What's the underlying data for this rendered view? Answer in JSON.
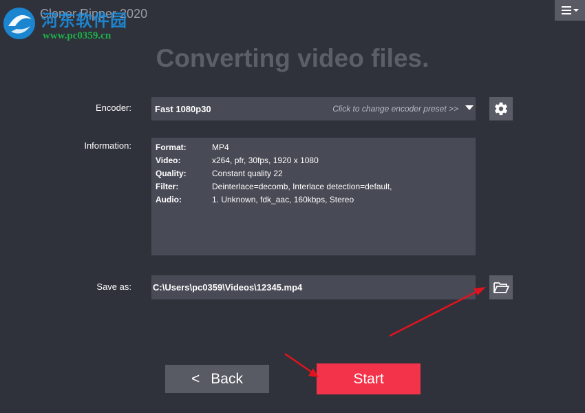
{
  "app": {
    "title": "Cloner Ripper 2020"
  },
  "watermark": {
    "site_name_cn": "河东软件园",
    "url": "www.pc0359.cn"
  },
  "heading": "Converting video files.",
  "encoder": {
    "label": "Encoder:",
    "value": "Fast 1080p30",
    "hint": "Click to change encoder preset >>"
  },
  "information": {
    "label": "Information:",
    "rows": [
      {
        "key": "Format:",
        "value": "MP4"
      },
      {
        "key": "Video:",
        "value": "x264, pfr, 30fps, 1920 x 1080"
      },
      {
        "key": "Quality:",
        "value": "Constant quality 22"
      },
      {
        "key": "Filter:",
        "value": "Deinterlace=decomb, Interlace detection=default,"
      },
      {
        "key": "Audio:",
        "value": "1. Unknown, fdk_aac, 160kbps, Stereo"
      }
    ]
  },
  "save_as": {
    "label": "Save as:",
    "value": "C:\\Users\\pc0359\\Videos\\12345.mp4"
  },
  "buttons": {
    "back_chevron": "<",
    "back_label": "Back",
    "start_label": "Start"
  },
  "icons": {
    "menu": "hamburger-menu-icon",
    "settings": "gear-icon",
    "folder": "folder-open-icon",
    "dropdown": "caret-down-icon"
  },
  "colors": {
    "background": "#2f313b",
    "panel": "#484a55",
    "button": "#585a64",
    "start": "#f3334a",
    "annotation_arrow": "#e0141e"
  }
}
